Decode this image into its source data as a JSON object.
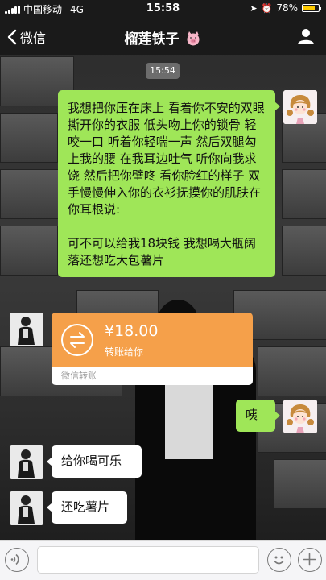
{
  "status_bar": {
    "carrier": "中国移动",
    "network": "4G",
    "time": "15:58",
    "battery_percent": "78%",
    "battery_level": 0.78
  },
  "nav": {
    "back_label": "微信",
    "title": "榴莲铁子"
  },
  "chat": {
    "timestamp": "15:54",
    "messages": [
      {
        "side": "right",
        "type": "text",
        "text": "我想把你压在床上 看着你不安的双眼 撕开你的衣服 低头吻上你的锁骨 轻咬一口 听着你轻喘一声 然后双腿勾上我的腰 在我耳边吐气 听你向我求饶 然后把你壁咚 看你脸红的样子 双手慢慢伸入你的衣衫抚摸你的肌肤在你耳根说:\n\n可不可以给我18块钱 我想喝大瓶阔落还想吃大包薯片"
      },
      {
        "side": "left",
        "type": "transfer",
        "amount": "¥18.00",
        "note": "转账给你",
        "footer": "微信转账"
      },
      {
        "side": "right",
        "type": "text",
        "text": "咦"
      },
      {
        "side": "left",
        "type": "text",
        "text": "给你喝可乐"
      },
      {
        "side": "left",
        "type": "text",
        "text": "还吃薯片"
      }
    ]
  },
  "colors": {
    "bubble_green": "#9fe658",
    "transfer_orange": "#f5a04a",
    "battery_yellow": "#ffcc00"
  },
  "icons": {
    "back": "chevron-left-icon",
    "profile": "person-icon",
    "title_emoji": "pig-face-icon",
    "transfer": "transfer-arrows-icon",
    "voice": "voice-icon",
    "emoji": "emoji-icon",
    "plus": "plus-icon"
  }
}
